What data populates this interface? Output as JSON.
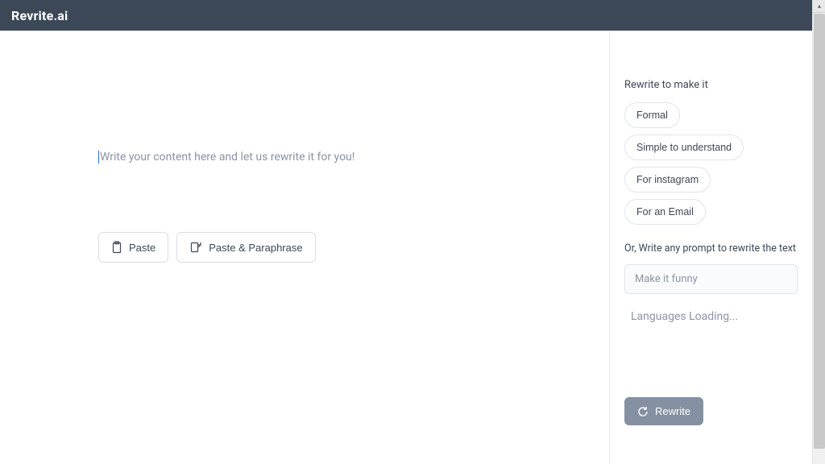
{
  "header": {
    "brand": "Revrite.ai"
  },
  "editor": {
    "placeholder": "Write your content here and let us rewrite it for you!",
    "buttons": {
      "paste": "Paste",
      "paste_paraphrase": "Paste & Paraphrase"
    }
  },
  "sidebar": {
    "title": "Rewrite to make it",
    "chips": [
      "Formal",
      "Simple to understand",
      "For instagram",
      "For an Email"
    ],
    "subtitle": "Or, Write any prompt to rewrite the text",
    "prompt_placeholder": "Make it funny",
    "loading_text": "Languages Loading...",
    "rewrite_button": "Rewrite"
  }
}
